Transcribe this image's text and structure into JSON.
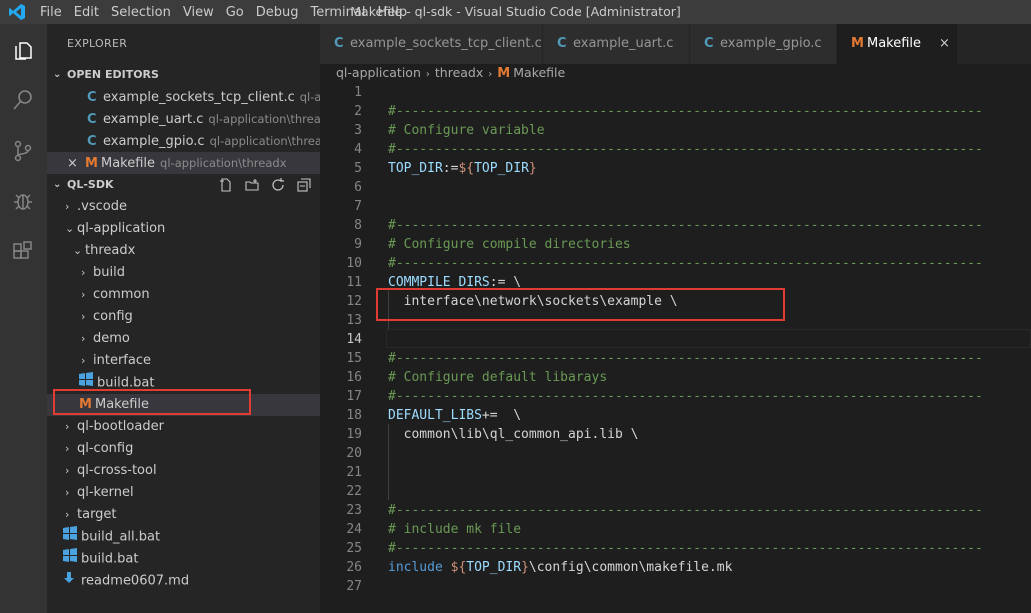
{
  "window": {
    "title": "Makefile - ql-sdk - Visual Studio Code [Administrator]",
    "menu": [
      "File",
      "Edit",
      "Selection",
      "View",
      "Go",
      "Debug",
      "Terminal",
      "Help"
    ]
  },
  "activity_bar": [
    "explorer-icon",
    "search-icon",
    "source-control-icon",
    "debug-icon",
    "extensions-icon"
  ],
  "sidebar": {
    "title": "EXPLORER",
    "open_editors": {
      "header": "OPEN EDITORS",
      "items": [
        {
          "icon": "C",
          "name": "example_sockets_tcp_client.c",
          "path": "ql-appl..."
        },
        {
          "icon": "C",
          "name": "example_uart.c",
          "path": "ql-application\\threadx..."
        },
        {
          "icon": "C",
          "name": "example_gpio.c",
          "path": "ql-application\\thread..."
        },
        {
          "icon": "M",
          "name": "Makefile",
          "path": "ql-application\\threadx",
          "close": "×"
        }
      ]
    },
    "workspace": {
      "header": "QL-SDK",
      "items": [
        {
          "name": ".vscode",
          "chev": "›"
        },
        {
          "name": "ql-application",
          "chev": "⌄"
        },
        {
          "name": "threadx",
          "chev": "⌄"
        },
        {
          "name": "build",
          "chev": "›"
        },
        {
          "name": "common",
          "chev": "›"
        },
        {
          "name": "config",
          "chev": "›"
        },
        {
          "name": "demo",
          "chev": "›"
        },
        {
          "name": "interface",
          "chev": "›"
        },
        {
          "name": "build.bat"
        },
        {
          "name": "Makefile",
          "icon": "M"
        },
        {
          "name": "ql-bootloader",
          "chev": "›"
        },
        {
          "name": "ql-config",
          "chev": "›"
        },
        {
          "name": "ql-cross-tool",
          "chev": "›"
        },
        {
          "name": "ql-kernel",
          "chev": "›"
        },
        {
          "name": "target",
          "chev": "›"
        },
        {
          "name": "build_all.bat"
        },
        {
          "name": "build.bat"
        },
        {
          "name": "readme0607.md"
        }
      ]
    }
  },
  "tabs": [
    {
      "icon": "C",
      "label": "example_sockets_tcp_client.c"
    },
    {
      "icon": "C",
      "label": "example_uart.c"
    },
    {
      "icon": "C",
      "label": "example_gpio.c"
    },
    {
      "icon": "M",
      "label": "Makefile",
      "close": "×"
    }
  ],
  "breadcrumb": {
    "parts": [
      "ql-application",
      "threadx",
      "Makefile"
    ],
    "sep": "›"
  },
  "editor": {
    "current_line": "14",
    "line_numbers": [
      "1",
      "2",
      "3",
      "4",
      "5",
      "6",
      "7",
      "8",
      "9",
      "10",
      "11",
      "12",
      "13",
      "14",
      "15",
      "16",
      "17",
      "18",
      "19",
      "20",
      "21",
      "22",
      "23",
      "24",
      "25",
      "26",
      "27"
    ],
    "dashes": "#---------------------------------------------------------------------------",
    "comments": [
      "# Configure variable",
      "# Configure compile directories",
      "# Configure default libarays",
      "# include mk file"
    ],
    "top_dir": {
      "name": "TOP_DIR",
      "op": ":=",
      "d1": "${",
      "ref": "TOP_DIR",
      "d2": "}"
    },
    "compile": {
      "name": "COMMPILE_DIRS",
      "op": ":= \\",
      "value": "  interface\\network\\sockets\\example \\"
    },
    "libs": {
      "name": "DEFAULT_LIBS",
      "op": "+=  \\",
      "value": "  common\\lib\\ql_common_api.lib \\"
    },
    "include": {
      "kw": "include",
      "d1": " ${",
      "ref": "TOP_DIR",
      "d2": "}",
      "rest": "\\config\\common\\makefile.mk"
    }
  }
}
